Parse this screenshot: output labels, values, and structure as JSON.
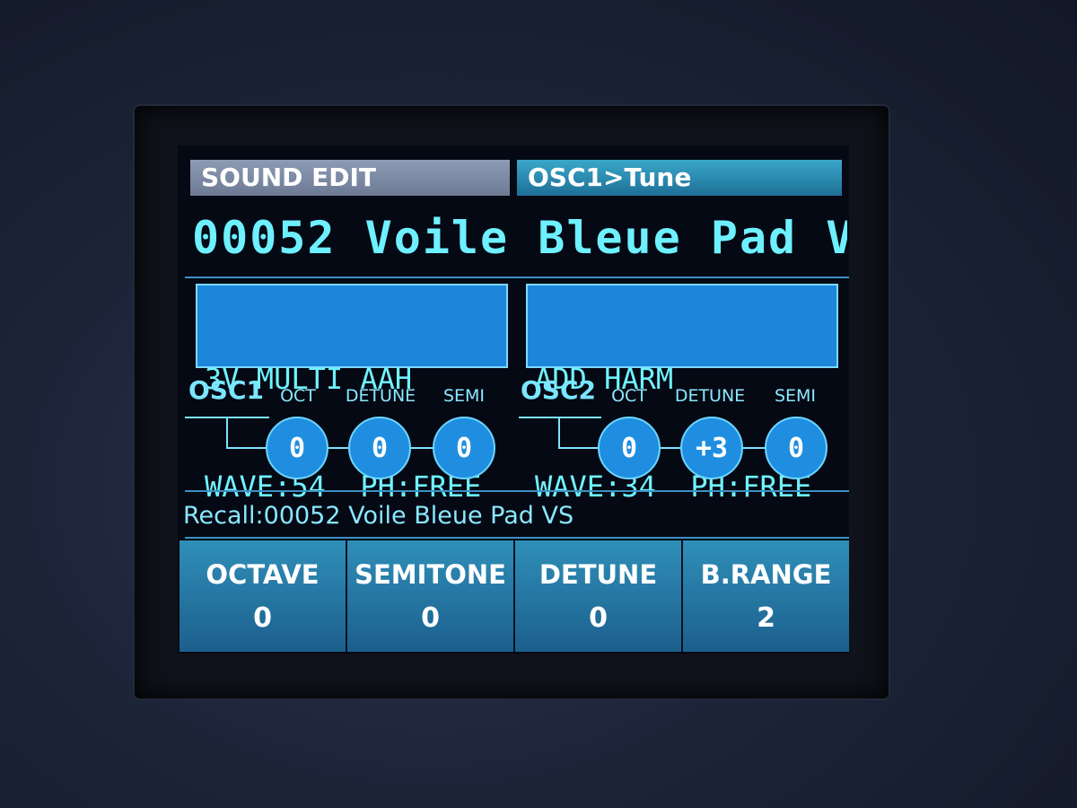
{
  "header": {
    "left": "SOUND EDIT",
    "right": "OSC1>Tune"
  },
  "patch_name": "00052 Voile Bleue Pad V",
  "osc1": {
    "title": "OSC1",
    "wave_line1": "3V MULTI AAH",
    "wave_line2": "WAVE:54  PH:FREE",
    "knobs": [
      {
        "label": "OCT",
        "value": "0"
      },
      {
        "label": "DETUNE",
        "value": "0"
      },
      {
        "label": "SEMI",
        "value": "0"
      }
    ]
  },
  "osc2": {
    "title": "OSC2",
    "wave_line1": "ADD HARM",
    "wave_line2": "WAVE:34  PH:FREE",
    "knobs": [
      {
        "label": "OCT",
        "value": "0"
      },
      {
        "label": "DETUNE",
        "value": "+3"
      },
      {
        "label": "SEMI",
        "value": "0"
      }
    ]
  },
  "recall": "Recall:00052 Voile Bleue Pad VS",
  "softkeys": [
    {
      "label": "OCTAVE",
      "value": "0"
    },
    {
      "label": "SEMITONE",
      "value": "0"
    },
    {
      "label": "DETUNE",
      "value": "0"
    },
    {
      "label": "B.RANGE",
      "value": "2"
    }
  ]
}
